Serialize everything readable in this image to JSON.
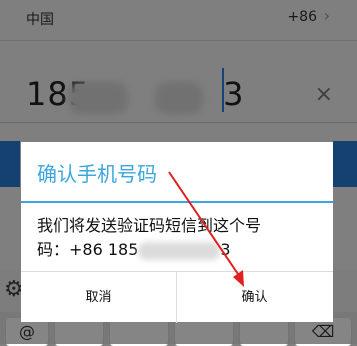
{
  "country": {
    "name": "中国",
    "code": "+86",
    "chevron": "chevron-right-icon"
  },
  "phone": {
    "prefix": "185",
    "suffix": "3",
    "clear_icon": "clear-icon"
  },
  "settings_icon": "gear-icon",
  "keyboard": {
    "first_key": "@",
    "backspace_icon": "backspace-icon"
  },
  "dialog": {
    "title": "确认手机号码",
    "line1": "我们将发送验证码短信到这个号",
    "line2_prefix": "码：+86 185",
    "line2_suffix": "3",
    "cancel": "取消",
    "confirm": "确认"
  },
  "colors": {
    "accent": "#3aa6dd",
    "arrow": "#e02020",
    "primary_button": "#2a7dd6"
  }
}
